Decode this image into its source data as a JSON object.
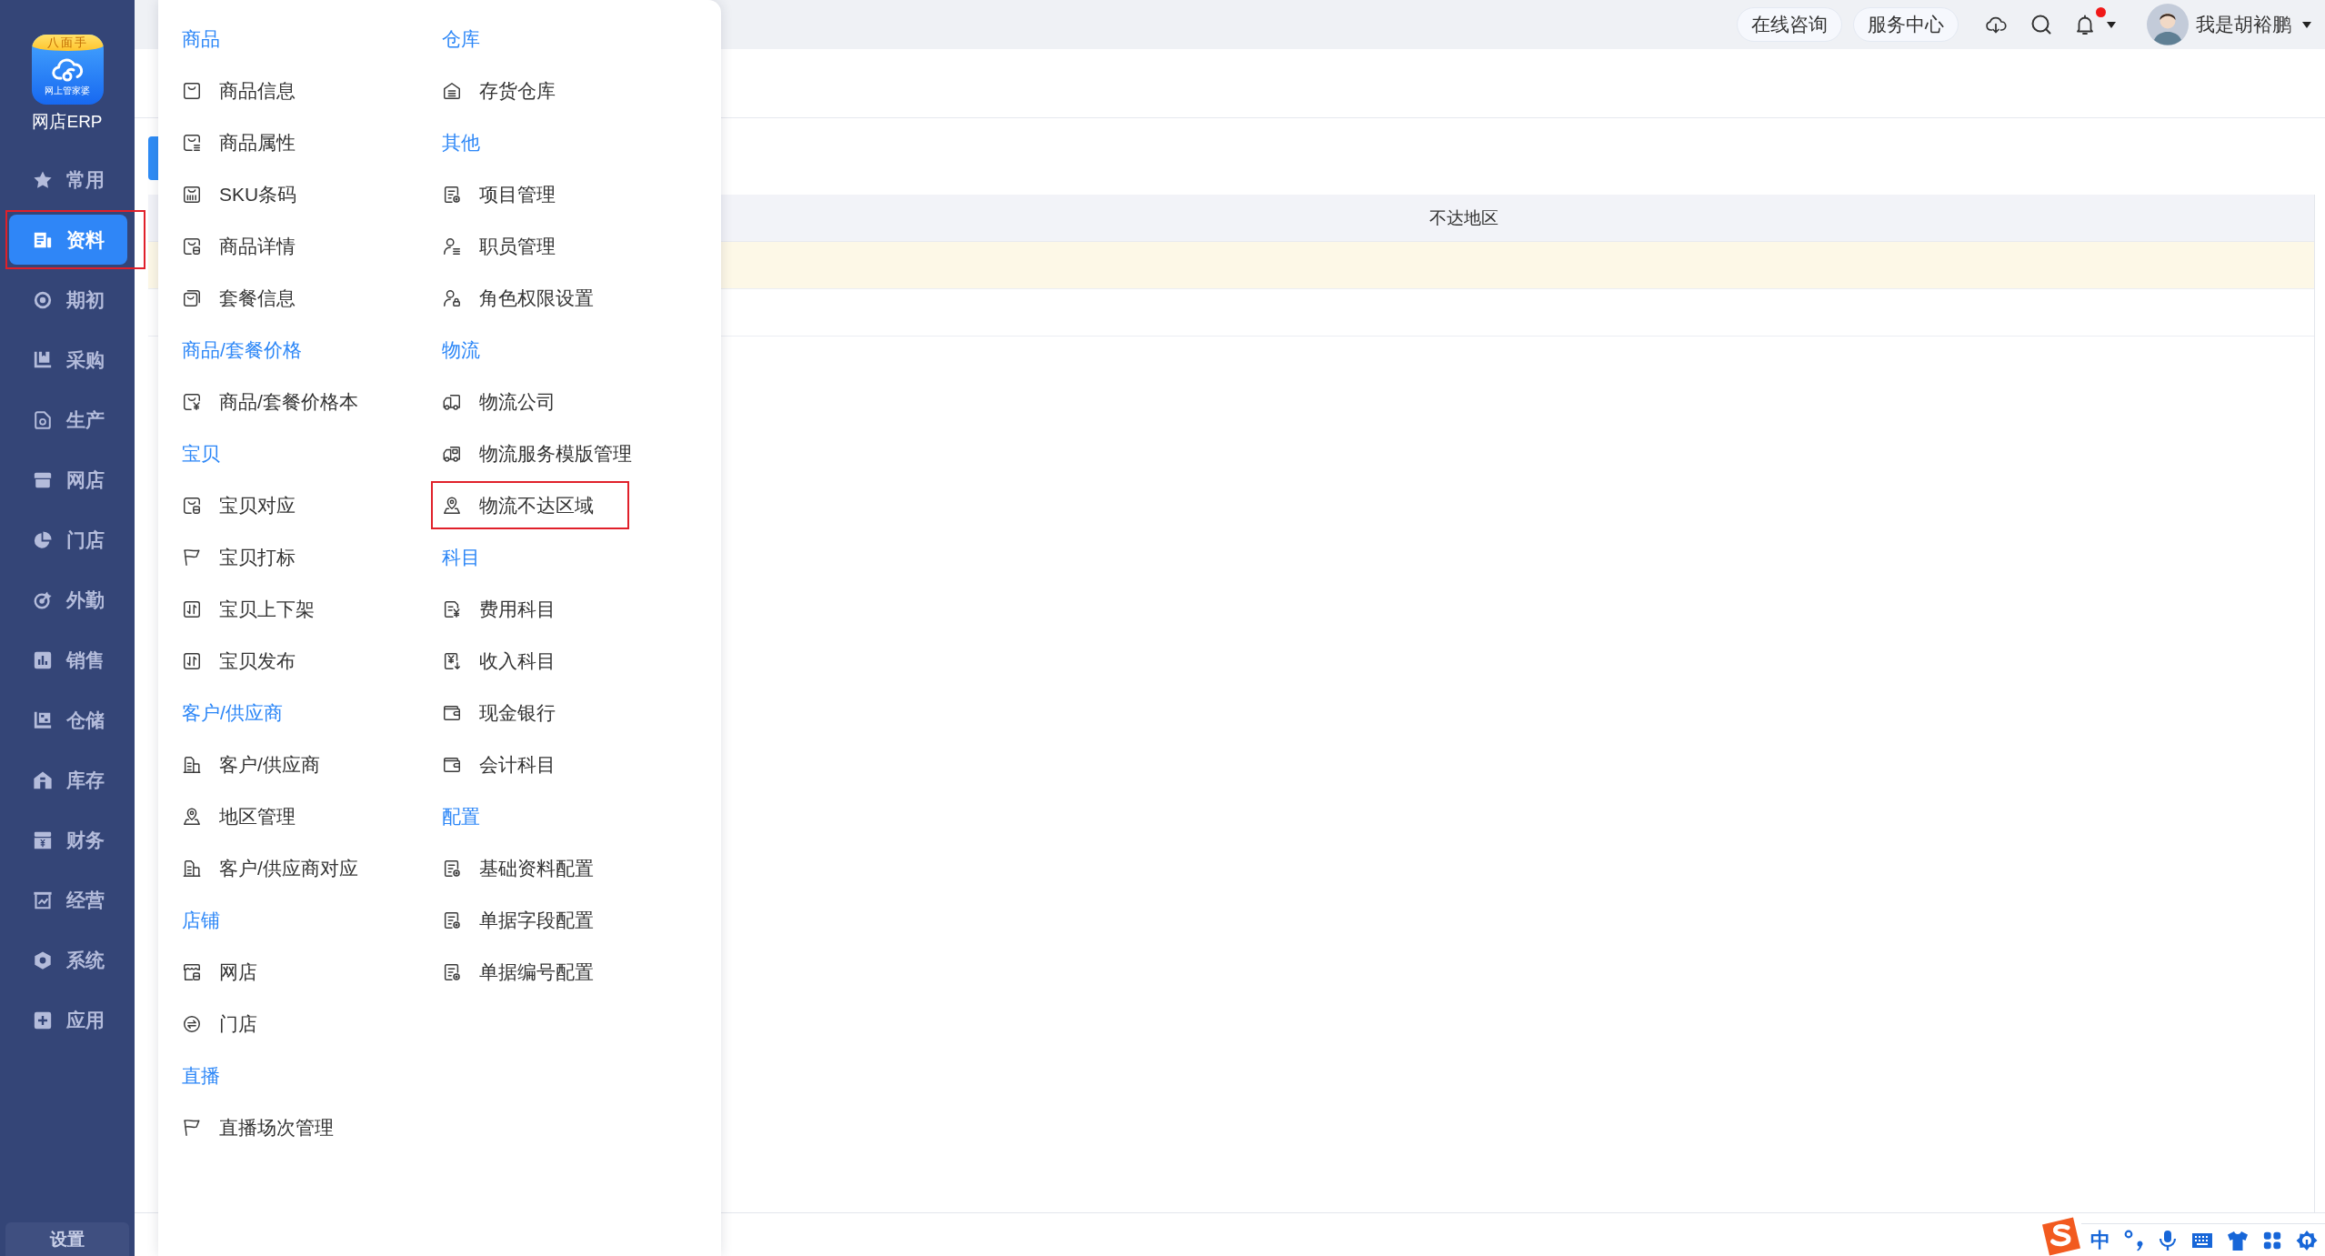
{
  "sidebar": {
    "logo": {
      "badge": "八面手",
      "caption": "网上管家婆"
    },
    "app_name": "网店ERP",
    "items": [
      {
        "label": "常用",
        "selected": false,
        "highlighted": false
      },
      {
        "label": "资料",
        "selected": true,
        "highlighted": true
      },
      {
        "label": "期初",
        "selected": false,
        "highlighted": false
      },
      {
        "label": "采购",
        "selected": false,
        "highlighted": false
      },
      {
        "label": "生产",
        "selected": false,
        "highlighted": false
      },
      {
        "label": "网店",
        "selected": false,
        "highlighted": false
      },
      {
        "label": "门店",
        "selected": false,
        "highlighted": false
      },
      {
        "label": "外勤",
        "selected": false,
        "highlighted": false
      },
      {
        "label": "销售",
        "selected": false,
        "highlighted": false
      },
      {
        "label": "仓储",
        "selected": false,
        "highlighted": false
      },
      {
        "label": "库存",
        "selected": false,
        "highlighted": false
      },
      {
        "label": "财务",
        "selected": false,
        "highlighted": false
      },
      {
        "label": "经营",
        "selected": false,
        "highlighted": false
      },
      {
        "label": "系统",
        "selected": false,
        "highlighted": false
      },
      {
        "label": "应用",
        "selected": false,
        "highlighted": false
      }
    ],
    "settings": "设置"
  },
  "header": {
    "links": [
      "在线咨询",
      "服务中心"
    ],
    "notifications": {
      "unread": true
    },
    "user": {
      "name": "我是胡裕鹏"
    }
  },
  "table": {
    "columns": [
      "不达地区"
    ],
    "rows": [
      {
        "selected": true
      },
      {
        "selected": false
      }
    ]
  },
  "menu": {
    "columns": [
      {
        "groups": [
          {
            "title": "商品",
            "items": [
              {
                "label": "商品信息",
                "highlighted": false
              },
              {
                "label": "商品属性",
                "highlighted": false
              },
              {
                "label": "SKU条码",
                "highlighted": false
              },
              {
                "label": "商品详情",
                "highlighted": false
              },
              {
                "label": "套餐信息",
                "highlighted": false
              }
            ]
          },
          {
            "title": "商品/套餐价格",
            "items": [
              {
                "label": "商品/套餐价格本",
                "highlighted": false
              }
            ]
          },
          {
            "title": "宝贝",
            "items": [
              {
                "label": "宝贝对应",
                "highlighted": false
              },
              {
                "label": "宝贝打标",
                "highlighted": false
              },
              {
                "label": "宝贝上下架",
                "highlighted": false
              },
              {
                "label": "宝贝发布",
                "highlighted": false
              }
            ]
          },
          {
            "title": "客户/供应商",
            "items": [
              {
                "label": "客户/供应商",
                "highlighted": false
              },
              {
                "label": "地区管理",
                "highlighted": false
              },
              {
                "label": "客户/供应商对应",
                "highlighted": false
              }
            ]
          },
          {
            "title": "店铺",
            "items": [
              {
                "label": "网店",
                "highlighted": false
              },
              {
                "label": "门店",
                "highlighted": false
              }
            ]
          },
          {
            "title": "直播",
            "items": [
              {
                "label": "直播场次管理",
                "highlighted": false
              }
            ]
          }
        ]
      },
      {
        "groups": [
          {
            "title": "仓库",
            "items": [
              {
                "label": "存货仓库",
                "highlighted": false
              }
            ]
          },
          {
            "title": "其他",
            "items": [
              {
                "label": "项目管理",
                "highlighted": false
              },
              {
                "label": "职员管理",
                "highlighted": false
              },
              {
                "label": "角色权限设置",
                "highlighted": false
              }
            ]
          },
          {
            "title": "物流",
            "items": [
              {
                "label": "物流公司",
                "highlighted": false
              },
              {
                "label": "物流服务模版管理",
                "highlighted": false
              },
              {
                "label": "物流不达区域",
                "highlighted": true
              }
            ]
          },
          {
            "title": "科目",
            "items": [
              {
                "label": "费用科目",
                "highlighted": false
              },
              {
                "label": "收入科目",
                "highlighted": false
              },
              {
                "label": "现金银行",
                "highlighted": false
              },
              {
                "label": "会计科目",
                "highlighted": false
              }
            ]
          },
          {
            "title": "配置",
            "items": [
              {
                "label": "基础资料配置",
                "highlighted": false
              },
              {
                "label": "单据字段配置",
                "highlighted": false
              },
              {
                "label": "单据编号配置",
                "highlighted": false
              }
            ]
          }
        ]
      }
    ]
  },
  "ime_toolbar": {
    "mode": "中"
  }
}
